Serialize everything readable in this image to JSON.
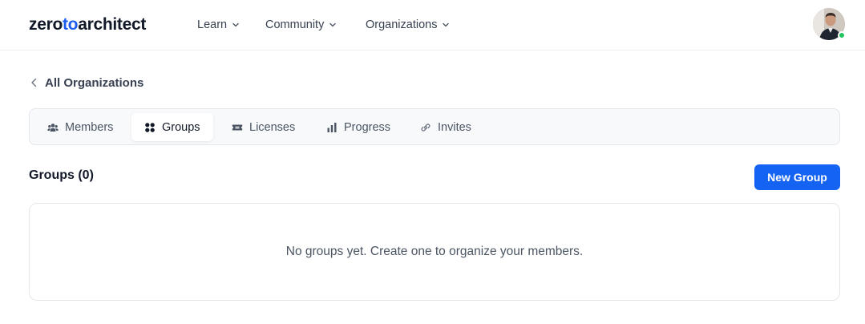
{
  "brand": {
    "part1": "zero",
    "part2": "to",
    "part3": "architect",
    "accent_color": "#1d5cf0"
  },
  "nav": [
    {
      "label": "Learn",
      "icon": "chevron-down-icon"
    },
    {
      "label": "Community",
      "icon": "chevron-down-icon"
    },
    {
      "label": "Organizations",
      "icon": "chevron-down-icon"
    }
  ],
  "user": {
    "status_color": "#22c55e"
  },
  "breadcrumb": {
    "label": "All Organizations",
    "icon": "chevron-left-icon"
  },
  "tabs": [
    {
      "label": "Members",
      "icon": "users-icon",
      "active": false
    },
    {
      "label": "Groups",
      "icon": "grid-icon",
      "active": true
    },
    {
      "label": "Licenses",
      "icon": "ticket-icon",
      "active": false
    },
    {
      "label": "Progress",
      "icon": "bar-chart-icon",
      "active": false
    },
    {
      "label": "Invites",
      "icon": "link-icon",
      "active": false
    }
  ],
  "section": {
    "title": "Groups (0)",
    "new_button_label": "New Group",
    "button_color": "#1463f3"
  },
  "empty_state": {
    "message": "No groups yet. Create one to organize your members."
  }
}
